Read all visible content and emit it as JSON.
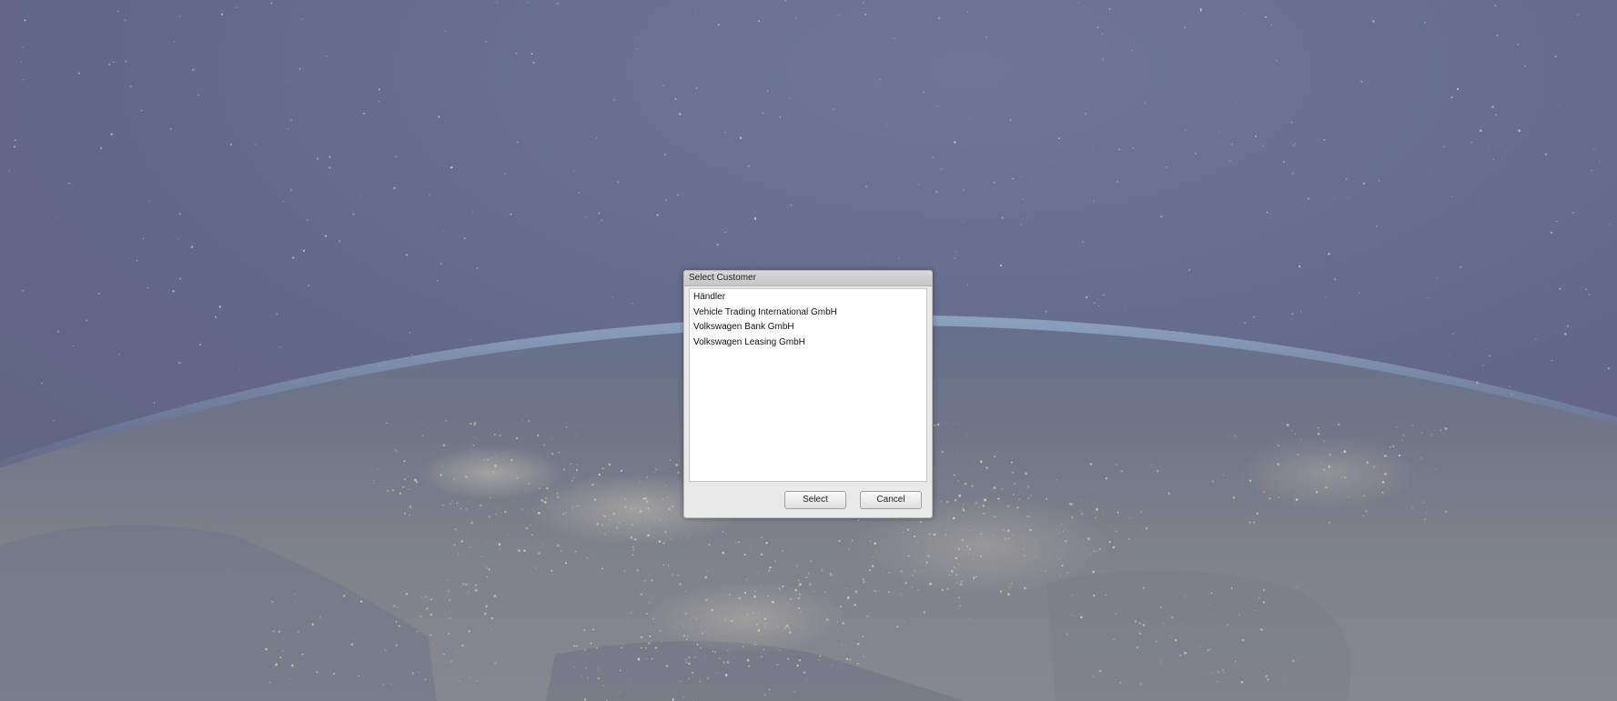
{
  "dialog": {
    "title": "Select Customer",
    "customers": [
      "Händler",
      "Vehicle Trading International GmbH",
      "Volkswagen Bank GmbH",
      "Volkswagen Leasing GmbH"
    ],
    "select_label": "Select",
    "cancel_label": "Cancel"
  },
  "background": {
    "scene": "earth-from-space-night-icon",
    "overlay_color": "#8890a8"
  }
}
